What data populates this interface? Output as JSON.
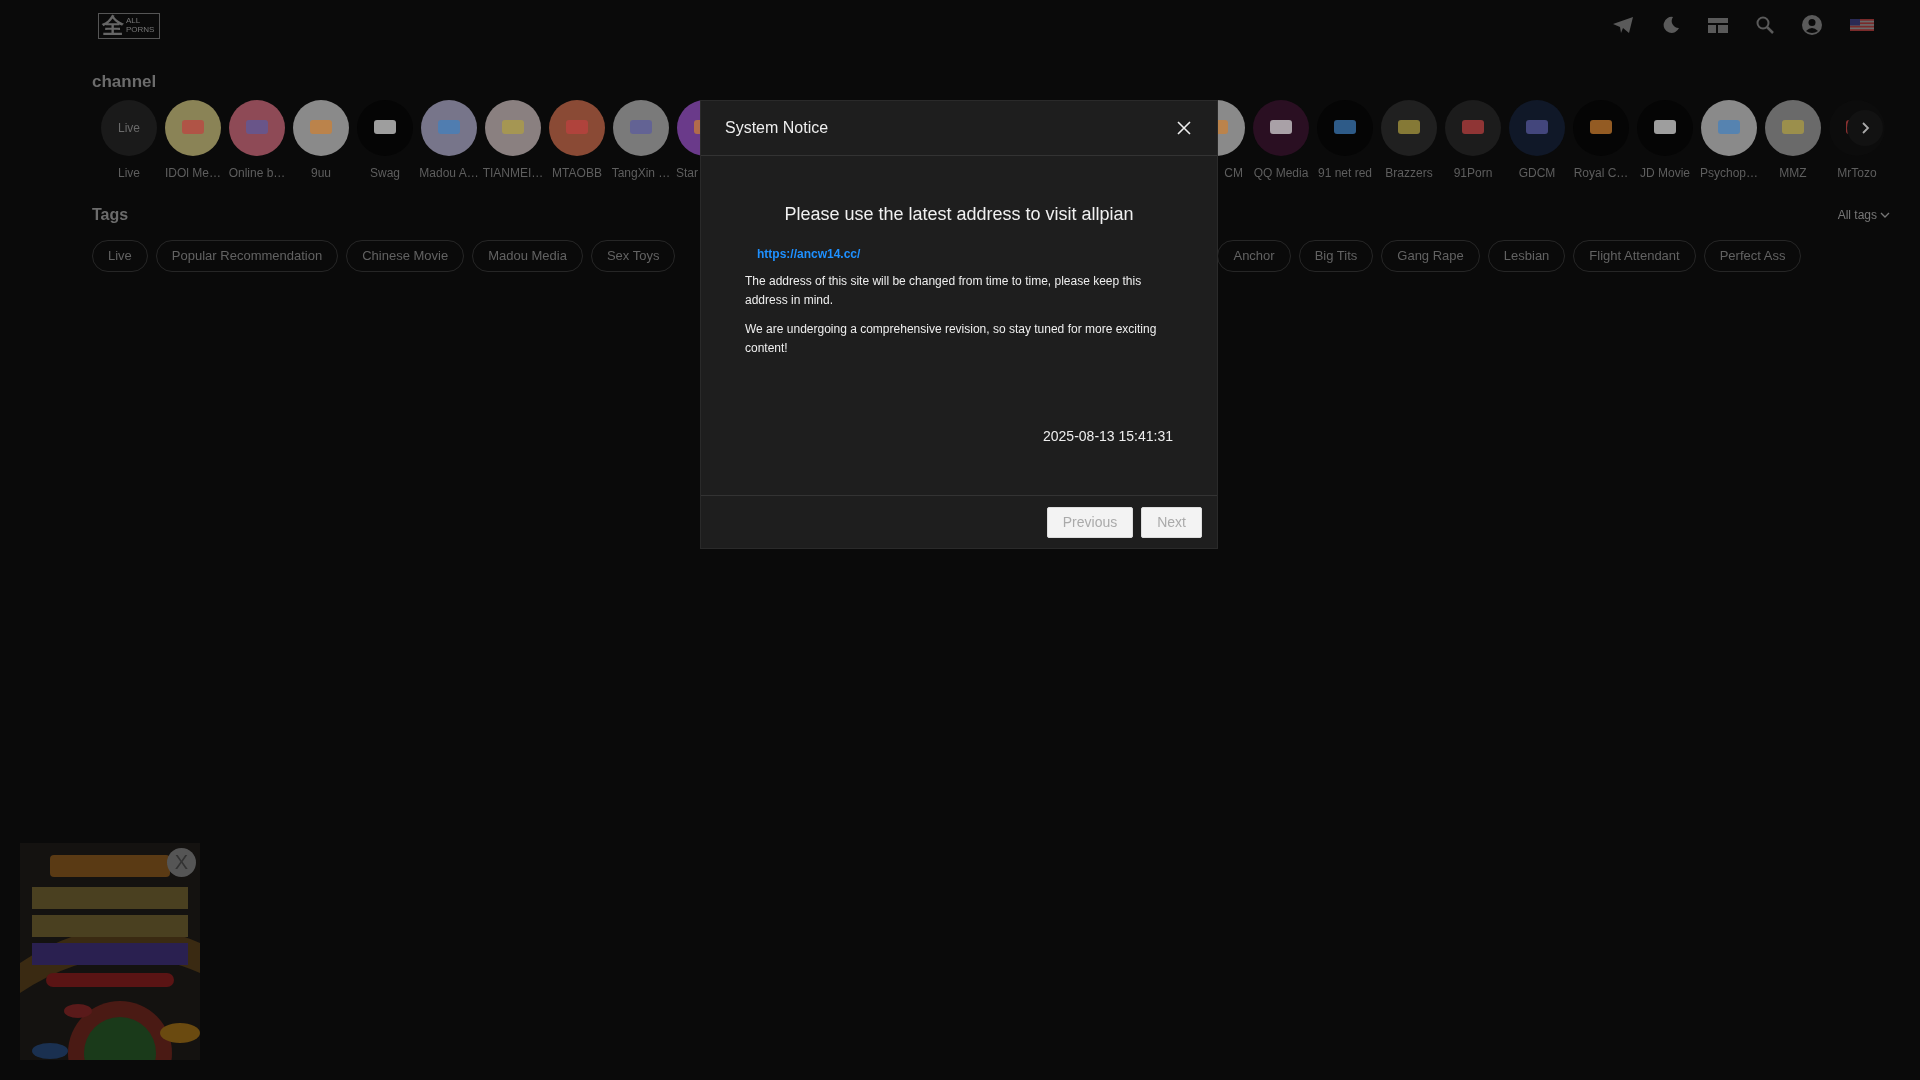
{
  "header": {
    "logo": {
      "mark": "全",
      "caption": "ALL PORNS"
    }
  },
  "channels": {
    "title": "channel",
    "left": [
      {
        "name": "Live",
        "logo_text": "Live"
      },
      {
        "name": "IDOl Me…"
      },
      {
        "name": "Online b…"
      },
      {
        "name": "9uu"
      },
      {
        "name": "Swag"
      },
      {
        "name": "Madou A…"
      },
      {
        "name": "TIANMEI…"
      },
      {
        "name": "MTAOBB"
      },
      {
        "name": "TangXin …"
      },
      {
        "name": "Star"
      }
    ],
    "right": [
      {
        "name": "CM"
      },
      {
        "name": "QQ Media"
      },
      {
        "name": "91 net red"
      },
      {
        "name": "Brazzers"
      },
      {
        "name": "91Porn"
      },
      {
        "name": "GDCM"
      },
      {
        "name": "Royal C…"
      },
      {
        "name": "JD Movie"
      },
      {
        "name": "Psychop…"
      },
      {
        "name": "MMZ"
      },
      {
        "name": "MrTozo"
      }
    ]
  },
  "tags": {
    "title": "Tags",
    "all_link": "All tags",
    "left": [
      {
        "label": "Live"
      },
      {
        "label": "Popular Recommendation"
      },
      {
        "label": "Chinese Movie"
      },
      {
        "label": "Madou Media"
      },
      {
        "label": "Sex Toys"
      }
    ],
    "right": [
      {
        "label": "Anchor"
      },
      {
        "label": "Big Tits"
      },
      {
        "label": "Gang Rape"
      },
      {
        "label": "Lesbian"
      },
      {
        "label": "Flight Attendant"
      },
      {
        "label": "Perfect Ass"
      }
    ]
  },
  "notice": {
    "title": "System Notice",
    "headline": "Please use the latest address to visit allpian",
    "link": "https://ancw14.cc/",
    "paragraphs": [
      "The address of this site will be changed from time to time, please keep this address in mind.",
      "We are undergoing a comprehensive revision, so stay tuned for more exciting content!"
    ],
    "date": "2025-08-13 15:41:31",
    "buttons": [
      {
        "label": "Previous",
        "disabled": true
      },
      {
        "label": "Next",
        "disabled": true
      }
    ]
  },
  "ad": {
    "kind": "picture",
    "close": "X"
  }
}
